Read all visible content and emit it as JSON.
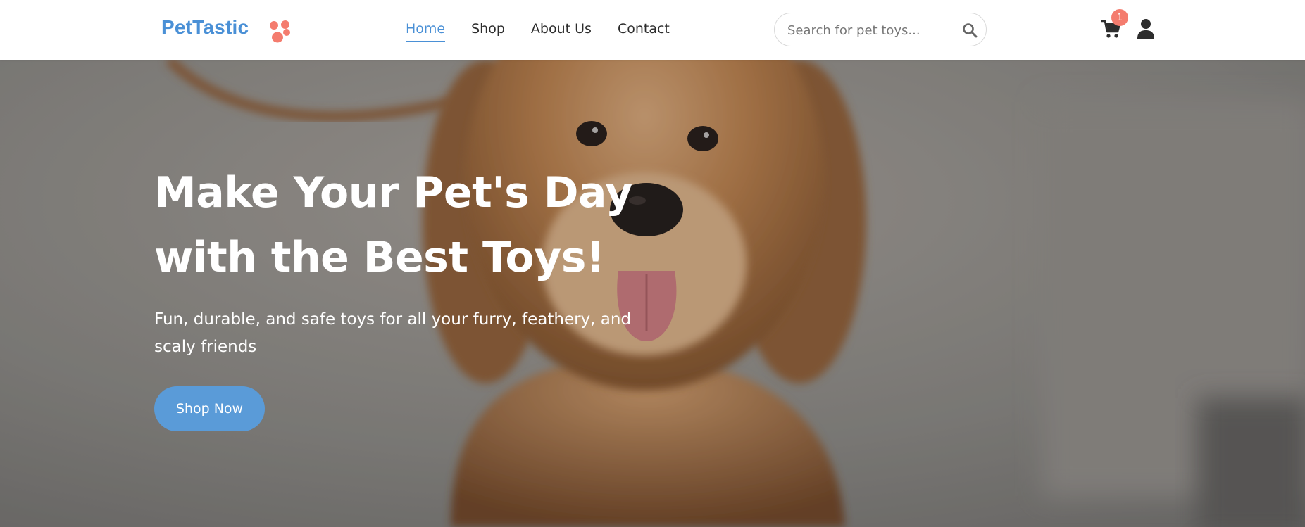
{
  "header": {
    "logo_text": "PetTastic",
    "logo_icon": "paw-icon",
    "nav": [
      {
        "label": "Home",
        "active": true
      },
      {
        "label": "Shop",
        "active": false
      },
      {
        "label": "About Us",
        "active": false
      },
      {
        "label": "Contact",
        "active": false
      }
    ],
    "search": {
      "placeholder": "Search for pet toys...",
      "value": "",
      "icon": "search-icon"
    },
    "cart": {
      "icon": "cart-icon",
      "count": "1"
    },
    "user": {
      "icon": "user-icon"
    }
  },
  "hero": {
    "title_line1": "Make Your Pet's Day",
    "title_line2": "with the Best Toys!",
    "subtitle": "Fun, durable, and safe toys for all your furry, feathery, and scaly friends",
    "cta_label": "Shop Now",
    "image": "dog-photo"
  },
  "colors": {
    "brand_blue": "#4a90d6",
    "button_blue": "#5a9bd8",
    "accent_coral": "#f47c6e",
    "text_dark": "#2d2d2d"
  }
}
